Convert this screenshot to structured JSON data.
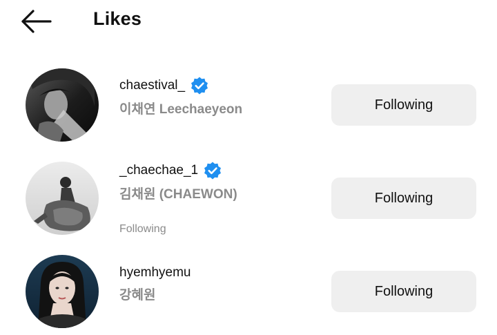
{
  "header": {
    "back_icon": "arrow-left-icon",
    "title": "Likes"
  },
  "users": [
    {
      "username": "chaestival_",
      "verified": true,
      "full_name": "이채연 Leechaeyeon",
      "subtext": "",
      "button_label": "Following"
    },
    {
      "username": "_chaechae_1",
      "verified": true,
      "full_name": "김채원 (CHAEWON)",
      "subtext": "Following",
      "button_label": "Following"
    },
    {
      "username": "hyemhyemu",
      "verified": false,
      "full_name": "강혜원",
      "subtext": "",
      "button_label": "Following"
    }
  ],
  "colors": {
    "verified_badge": "#1f8ff0",
    "button_bg": "#efefef",
    "secondary_text": "#8a8a8a"
  }
}
